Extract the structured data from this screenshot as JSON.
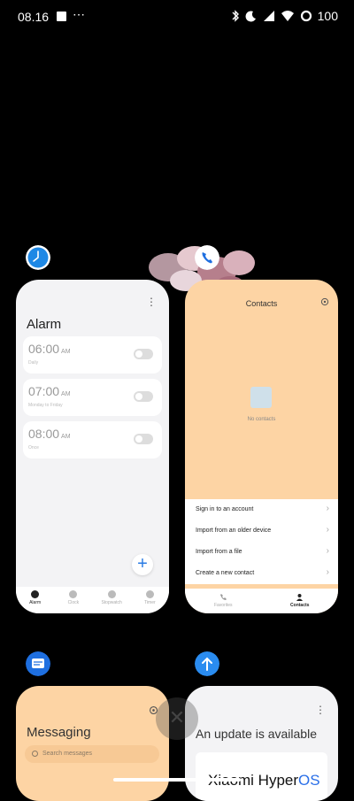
{
  "status": {
    "time": "08.16",
    "battery": "100"
  },
  "alarm": {
    "title": "Alarm",
    "alarms": [
      {
        "time": "06:00",
        "ampm": "AM",
        "sub": "Daily"
      },
      {
        "time": "07:00",
        "ampm": "AM",
        "sub": "Monday to Friday"
      },
      {
        "time": "08:00",
        "ampm": "AM",
        "sub": "Once"
      }
    ],
    "nav": [
      "Alarm",
      "Clock",
      "Stopwatch",
      "Timer"
    ],
    "fab": "+"
  },
  "contacts": {
    "title": "Contacts",
    "empty": "No contacts",
    "options": [
      "Sign in to an account",
      "Import from an older device",
      "Import from a file",
      "Create a new contact"
    ],
    "nav": [
      "Favorites",
      "Contacts"
    ]
  },
  "messaging": {
    "title": "Messaging",
    "search_placeholder": "Search messages"
  },
  "update": {
    "title": "An update is available",
    "brand_prefix": "Xiaomi Hyper",
    "brand_suffix": "OS"
  },
  "colors": {
    "contacts_bg": "#fdd4a4",
    "accent": "#2a7be4"
  }
}
